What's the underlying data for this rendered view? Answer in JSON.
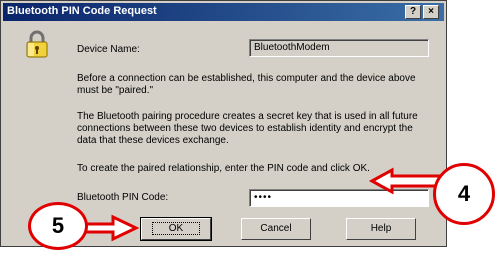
{
  "window": {
    "title": "Bluetooth PIN Code Request",
    "help_button": "?",
    "close_button": "×"
  },
  "device": {
    "label": "Device Name:",
    "value": "BluetoothModem"
  },
  "paragraphs": {
    "p1": "Before a connection can be established, this computer and the device above must be \"paired.\"",
    "p2": "The Bluetooth pairing procedure creates a secret key that is used in all future connections between these two devices to establish identity and encrypt the data that these devices exchange.",
    "p3": "To create the paired relationship, enter the PIN code and click OK."
  },
  "pin": {
    "label": "Bluetooth PIN Code:",
    "value": "••••"
  },
  "buttons": {
    "ok": "OK",
    "cancel": "Cancel",
    "help": "Help"
  },
  "callouts": {
    "step4": "4",
    "step5": "5"
  },
  "colors": {
    "callout": "#e00000"
  }
}
